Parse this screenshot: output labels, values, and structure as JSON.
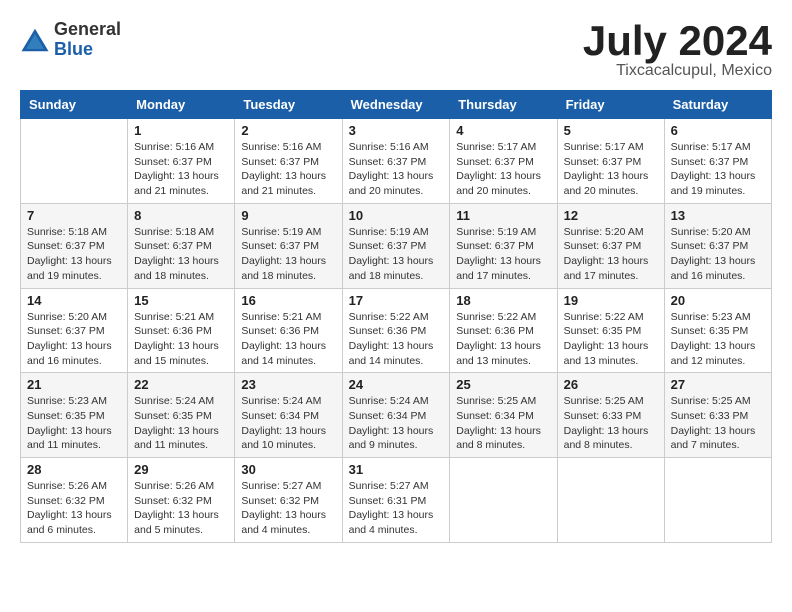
{
  "header": {
    "logo_general": "General",
    "logo_blue": "Blue",
    "month_title": "July 2024",
    "location": "Tixcacalcupul, Mexico"
  },
  "calendar": {
    "days_of_week": [
      "Sunday",
      "Monday",
      "Tuesday",
      "Wednesday",
      "Thursday",
      "Friday",
      "Saturday"
    ],
    "weeks": [
      [
        {
          "day": "",
          "info": ""
        },
        {
          "day": "1",
          "info": "Sunrise: 5:16 AM\nSunset: 6:37 PM\nDaylight: 13 hours\nand 21 minutes."
        },
        {
          "day": "2",
          "info": "Sunrise: 5:16 AM\nSunset: 6:37 PM\nDaylight: 13 hours\nand 21 minutes."
        },
        {
          "day": "3",
          "info": "Sunrise: 5:16 AM\nSunset: 6:37 PM\nDaylight: 13 hours\nand 20 minutes."
        },
        {
          "day": "4",
          "info": "Sunrise: 5:17 AM\nSunset: 6:37 PM\nDaylight: 13 hours\nand 20 minutes."
        },
        {
          "day": "5",
          "info": "Sunrise: 5:17 AM\nSunset: 6:37 PM\nDaylight: 13 hours\nand 20 minutes."
        },
        {
          "day": "6",
          "info": "Sunrise: 5:17 AM\nSunset: 6:37 PM\nDaylight: 13 hours\nand 19 minutes."
        }
      ],
      [
        {
          "day": "7",
          "info": "Sunrise: 5:18 AM\nSunset: 6:37 PM\nDaylight: 13 hours\nand 19 minutes."
        },
        {
          "day": "8",
          "info": "Sunrise: 5:18 AM\nSunset: 6:37 PM\nDaylight: 13 hours\nand 18 minutes."
        },
        {
          "day": "9",
          "info": "Sunrise: 5:19 AM\nSunset: 6:37 PM\nDaylight: 13 hours\nand 18 minutes."
        },
        {
          "day": "10",
          "info": "Sunrise: 5:19 AM\nSunset: 6:37 PM\nDaylight: 13 hours\nand 18 minutes."
        },
        {
          "day": "11",
          "info": "Sunrise: 5:19 AM\nSunset: 6:37 PM\nDaylight: 13 hours\nand 17 minutes."
        },
        {
          "day": "12",
          "info": "Sunrise: 5:20 AM\nSunset: 6:37 PM\nDaylight: 13 hours\nand 17 minutes."
        },
        {
          "day": "13",
          "info": "Sunrise: 5:20 AM\nSunset: 6:37 PM\nDaylight: 13 hours\nand 16 minutes."
        }
      ],
      [
        {
          "day": "14",
          "info": "Sunrise: 5:20 AM\nSunset: 6:37 PM\nDaylight: 13 hours\nand 16 minutes."
        },
        {
          "day": "15",
          "info": "Sunrise: 5:21 AM\nSunset: 6:36 PM\nDaylight: 13 hours\nand 15 minutes."
        },
        {
          "day": "16",
          "info": "Sunrise: 5:21 AM\nSunset: 6:36 PM\nDaylight: 13 hours\nand 14 minutes."
        },
        {
          "day": "17",
          "info": "Sunrise: 5:22 AM\nSunset: 6:36 PM\nDaylight: 13 hours\nand 14 minutes."
        },
        {
          "day": "18",
          "info": "Sunrise: 5:22 AM\nSunset: 6:36 PM\nDaylight: 13 hours\nand 13 minutes."
        },
        {
          "day": "19",
          "info": "Sunrise: 5:22 AM\nSunset: 6:35 PM\nDaylight: 13 hours\nand 13 minutes."
        },
        {
          "day": "20",
          "info": "Sunrise: 5:23 AM\nSunset: 6:35 PM\nDaylight: 13 hours\nand 12 minutes."
        }
      ],
      [
        {
          "day": "21",
          "info": "Sunrise: 5:23 AM\nSunset: 6:35 PM\nDaylight: 13 hours\nand 11 minutes."
        },
        {
          "day": "22",
          "info": "Sunrise: 5:24 AM\nSunset: 6:35 PM\nDaylight: 13 hours\nand 11 minutes."
        },
        {
          "day": "23",
          "info": "Sunrise: 5:24 AM\nSunset: 6:34 PM\nDaylight: 13 hours\nand 10 minutes."
        },
        {
          "day": "24",
          "info": "Sunrise: 5:24 AM\nSunset: 6:34 PM\nDaylight: 13 hours\nand 9 minutes."
        },
        {
          "day": "25",
          "info": "Sunrise: 5:25 AM\nSunset: 6:34 PM\nDaylight: 13 hours\nand 8 minutes."
        },
        {
          "day": "26",
          "info": "Sunrise: 5:25 AM\nSunset: 6:33 PM\nDaylight: 13 hours\nand 8 minutes."
        },
        {
          "day": "27",
          "info": "Sunrise: 5:25 AM\nSunset: 6:33 PM\nDaylight: 13 hours\nand 7 minutes."
        }
      ],
      [
        {
          "day": "28",
          "info": "Sunrise: 5:26 AM\nSunset: 6:32 PM\nDaylight: 13 hours\nand 6 minutes."
        },
        {
          "day": "29",
          "info": "Sunrise: 5:26 AM\nSunset: 6:32 PM\nDaylight: 13 hours\nand 5 minutes."
        },
        {
          "day": "30",
          "info": "Sunrise: 5:27 AM\nSunset: 6:32 PM\nDaylight: 13 hours\nand 4 minutes."
        },
        {
          "day": "31",
          "info": "Sunrise: 5:27 AM\nSunset: 6:31 PM\nDaylight: 13 hours\nand 4 minutes."
        },
        {
          "day": "",
          "info": ""
        },
        {
          "day": "",
          "info": ""
        },
        {
          "day": "",
          "info": ""
        }
      ]
    ]
  }
}
